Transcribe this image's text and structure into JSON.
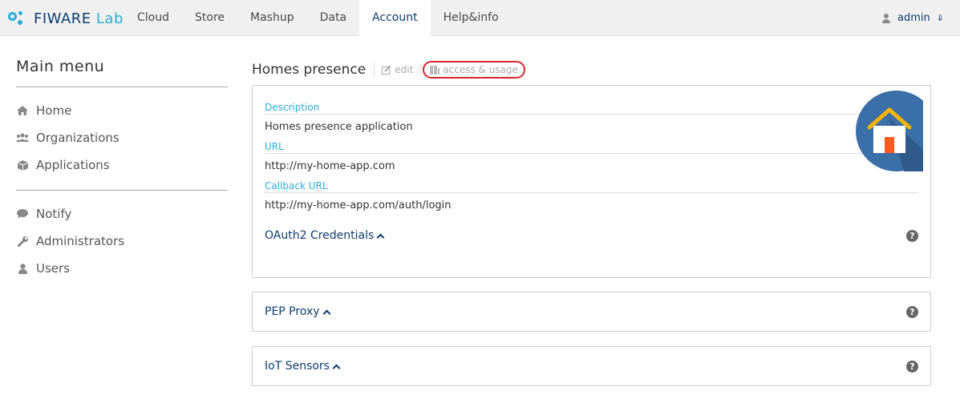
{
  "brand": {
    "name_dark": "FIWARE",
    "name_light": "Lab"
  },
  "nav": {
    "items": [
      {
        "label": "Cloud"
      },
      {
        "label": "Store"
      },
      {
        "label": "Mashup"
      },
      {
        "label": "Data"
      },
      {
        "label": "Account",
        "active": true
      },
      {
        "label": "Help&info"
      }
    ]
  },
  "user": {
    "name": "admin"
  },
  "sidebar": {
    "title": "Main menu",
    "groups": [
      [
        {
          "label": "Home",
          "icon": "home-icon"
        },
        {
          "label": "Organizations",
          "icon": "users-icon"
        },
        {
          "label": "Applications",
          "icon": "cube-icon"
        }
      ],
      [
        {
          "label": "Notify",
          "icon": "comment-icon"
        },
        {
          "label": "Administrators",
          "icon": "wrench-icon"
        },
        {
          "label": "Users",
          "icon": "user-icon"
        }
      ]
    ]
  },
  "app": {
    "title": "Homes presence",
    "edit_label": "edit",
    "access_label": "access & usage",
    "fields": [
      {
        "label": "Description",
        "value": "Homes presence application"
      },
      {
        "label": "URL",
        "value": "http://my-home-app.com"
      },
      {
        "label": "Callback URL",
        "value": "http://my-home-app.com/auth/login"
      }
    ],
    "sections": {
      "oauth": "OAuth2 Credentials",
      "pep": "PEP Proxy",
      "iot": "IoT Sensors"
    }
  },
  "colors": {
    "accent": "#2aaedc",
    "brand_dark": "#0d3d6e",
    "highlight": "#d9262c"
  }
}
